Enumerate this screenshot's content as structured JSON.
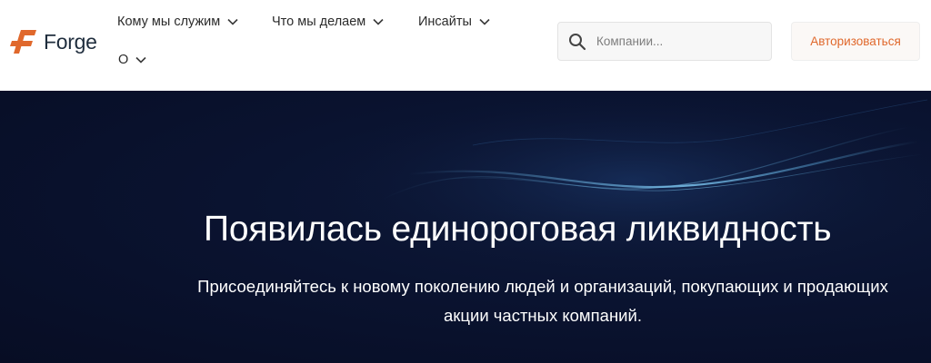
{
  "header": {
    "logo_text": "Forge",
    "brand_color": "#e0682c",
    "nav": [
      {
        "label": "Кому мы служим",
        "icon": "chevron-down-icon"
      },
      {
        "label": "Что мы делаем",
        "icon": "chevron-down-icon"
      },
      {
        "label": "Инсайты",
        "icon": "chevron-down-icon"
      },
      {
        "label": "О",
        "icon": "chevron-down-icon"
      }
    ],
    "search": {
      "placeholder": "Компании...",
      "value": "",
      "icon": "search-icon"
    },
    "login_label": "Авторизоваться"
  },
  "hero": {
    "title": "Появилась единороговая ликвидность",
    "subtitle": "Присоединяйтесь к новому поколению людей и организаций, покупающих и продающих акции частных компаний.",
    "background_color": "#0a1330"
  }
}
